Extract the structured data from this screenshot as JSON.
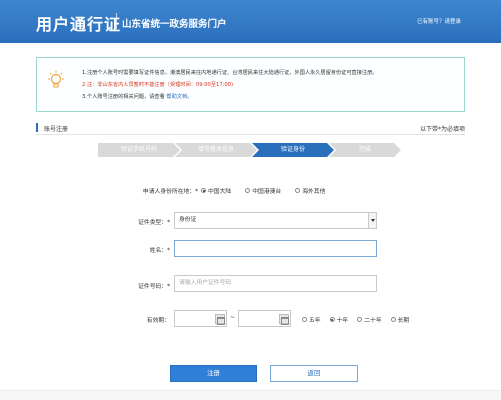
{
  "header": {
    "logo": "用户通行证",
    "subtitle": "山东省统一政务服务门户",
    "login_link": "已有账号？请登录"
  },
  "notice": {
    "line1": "1.注册个人账号时需要填写证件信息，港澳居民来往内地通行证、台湾居民来往大陆通行证、外国人永久居留身份证可直接注册。",
    "line2": "2.注：非山东省内人员暂时不能注册（受理时间：09:00至17:00)",
    "line3_prefix": "3.个人账号注册的相关问题，请查看",
    "line3_link": "帮助文档。"
  },
  "section": {
    "title": "账号注册",
    "note": "以下带*为必填项"
  },
  "steps": [
    {
      "label": "验证手机号码"
    },
    {
      "label": "填写基本信息"
    },
    {
      "label": "验证身份"
    },
    {
      "label": "完成"
    }
  ],
  "form": {
    "origin_label": "申请人身份所在地：*",
    "origin_options": [
      "中国大陆",
      "中国港澳台",
      "海外其他"
    ],
    "id_type_label": "证件类型：*",
    "id_type_value": "身份证",
    "name_label": "姓名：*",
    "name_value": "",
    "id_number_label": "证件号码：*",
    "id_number_placeholder": "请输入用户证件号码",
    "validity_label": "有效期：",
    "tilde": "~",
    "validity_options": [
      "五年",
      "十年",
      "二十年",
      "长期"
    ]
  },
  "buttons": {
    "register": "注册",
    "back": "返回"
  },
  "colors": {
    "brand_blue": "#2a6fbc",
    "notice_border": "#9bd7cf",
    "step_inactive": "#d9d9d9",
    "notice_red": "#d8341f"
  }
}
